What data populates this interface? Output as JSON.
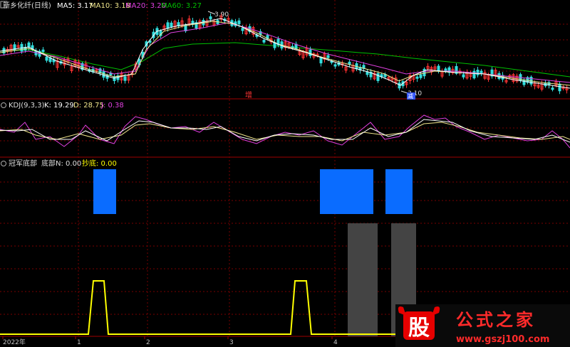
{
  "panel_main": {
    "stock_name": "新乡化纤(日线)",
    "ma5": "MA5: 3.17",
    "ma10": "MA10: 3.18",
    "ma20": "MA20: 3.20",
    "ma60": "MA60: 3.27",
    "high_label": "3.90",
    "low_label": "3.10",
    "zeng_label": "增",
    "jin_label": "减"
  },
  "panel_kdj": {
    "title": "KDJ(9,3,3)",
    "k": "K: 19.29",
    "d": "D: 28.75",
    "j": "J: 0.38"
  },
  "panel_guanjun": {
    "title": "冠军底部",
    "dibu": "底部N: 0.00",
    "chaodi": "抄底: 0.00"
  },
  "x_axis": {
    "ticks": [
      "2022年",
      "1",
      "2",
      "3",
      "4"
    ]
  },
  "watermark": {
    "logo_char": "股",
    "site_name": "公式之家",
    "url": "www.gszj100.com"
  },
  "colors": {
    "background": "#000000",
    "grid": "#7a0000",
    "ma5": "#ffffff",
    "ma10": "#f0e68c",
    "ma20": "#e040e0",
    "ma60": "#00c000",
    "up": "#ff3333",
    "down": "#33dddd",
    "kdj_k": "#ffffff",
    "kdj_d": "#f0e68c",
    "kdj_j": "#e040e0",
    "blue_bar": "#0a6cff",
    "gray_bar": "#444444",
    "yellow_line": "#ffff00"
  },
  "chart_data": [
    {
      "type": "line",
      "series": [
        {
          "name": "MA5",
          "values": [
            3.17
          ]
        },
        {
          "name": "MA10",
          "values": [
            3.18
          ]
        },
        {
          "name": "MA20",
          "values": [
            3.2
          ]
        },
        {
          "name": "MA60",
          "values": [
            3.27
          ]
        }
      ],
      "annotations": [
        "3.90",
        "3.10"
      ]
    },
    {
      "type": "line",
      "series": [
        {
          "name": "K",
          "values": [
            19.29
          ]
        },
        {
          "name": "D",
          "values": [
            28.75
          ]
        },
        {
          "name": "J",
          "values": [
            0.38
          ]
        }
      ]
    },
    {
      "type": "bar",
      "series": [
        {
          "name": "底部N",
          "values": [
            0.0
          ]
        },
        {
          "name": "抄底",
          "values": [
            0.0
          ]
        }
      ]
    }
  ]
}
